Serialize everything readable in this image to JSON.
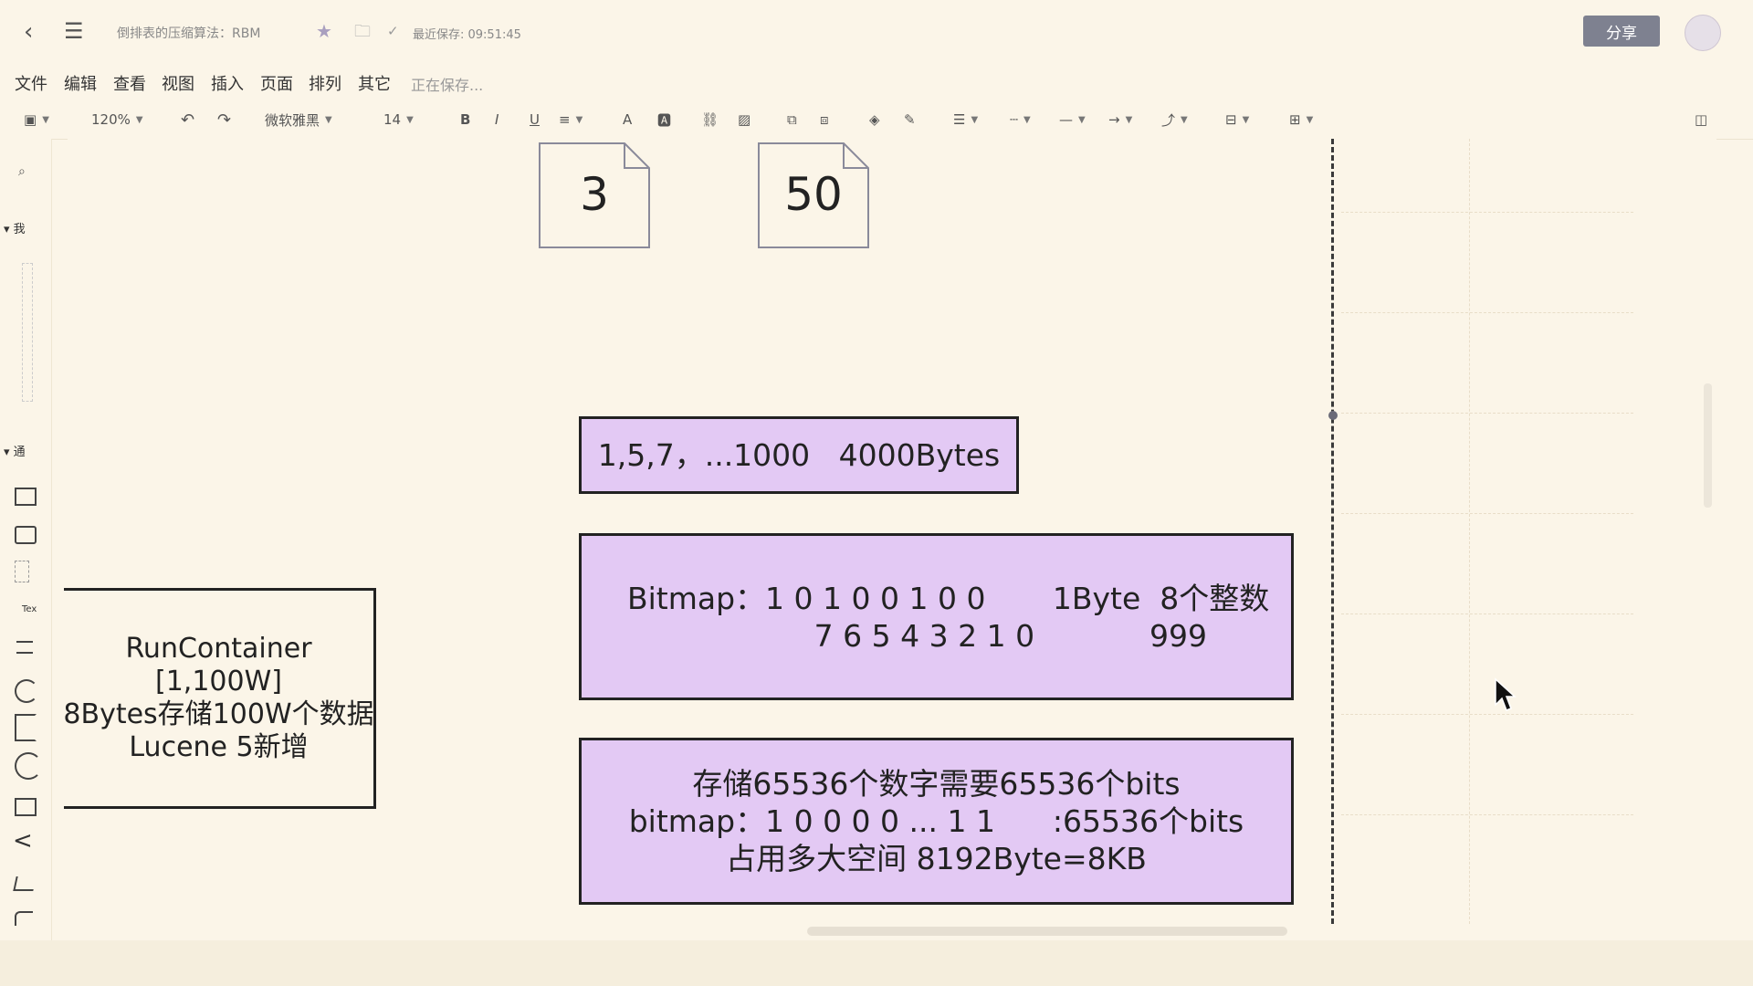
{
  "header": {
    "doc_title": "倒排表的压缩算法：RBM",
    "save_status": "最近保存: 09:51:45",
    "share_label": "分享"
  },
  "menu": [
    "文件",
    "编辑",
    "查看",
    "视图",
    "插入",
    "页面",
    "排列",
    "其它"
  ],
  "menu_status": "正在保存...",
  "toolbar": {
    "zoom": "120%",
    "font": "微软雅黑",
    "font_size": "14"
  },
  "left_panel": {
    "section_mine": "我",
    "section_general": "通",
    "text_shape_label": "Tex",
    "more_label": "+..."
  },
  "canvas": {
    "doc_values": [
      "3",
      "50"
    ],
    "box_array": "1,5,7，...1000   4000Bytes",
    "box_bitmap": "Bitmap：1 0 1 0 0 1 0 0       1Byte  8个整数\n             7 6 5 4 3 2 1 0            999",
    "box_storage": "存储65536个数字需要65536个bits\nbitmap：1 0 0 0 0 ... 1 1      :65536个bits\n占用多大空间 8192Byte=8KB",
    "box_run": "RunContainer\n[1,100W]\n8Bytes存储100W个数据\nLucene 5新增"
  }
}
